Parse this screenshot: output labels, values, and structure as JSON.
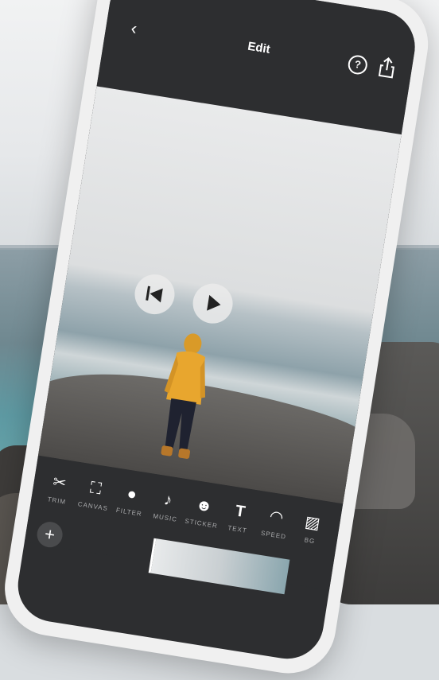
{
  "header": {
    "title": "Edit",
    "back_icon": "chevron-left-icon",
    "help_icon": "question-circle-icon",
    "share_icon": "share-icon"
  },
  "player": {
    "prev_icon": "skip-back-icon",
    "play_icon": "play-icon"
  },
  "tools": [
    {
      "label": "TRIM",
      "icon": "scissors-icon"
    },
    {
      "label": "CANVAS",
      "icon": "canvas-icon"
    },
    {
      "label": "FILTER",
      "icon": "filter-icon"
    },
    {
      "label": "MUSIC",
      "icon": "music-note-icon"
    },
    {
      "label": "STICKER",
      "icon": "sticker-icon"
    },
    {
      "label": "TEXT",
      "icon": "text-icon"
    },
    {
      "label": "SPEED",
      "icon": "speed-icon"
    },
    {
      "label": "BG",
      "icon": "background-icon"
    }
  ],
  "add_icon": "plus-icon",
  "colors": {
    "ui_dark": "#2d2e30",
    "phone_frame": "#f0f0f0",
    "jacket": "#e8a62e"
  }
}
